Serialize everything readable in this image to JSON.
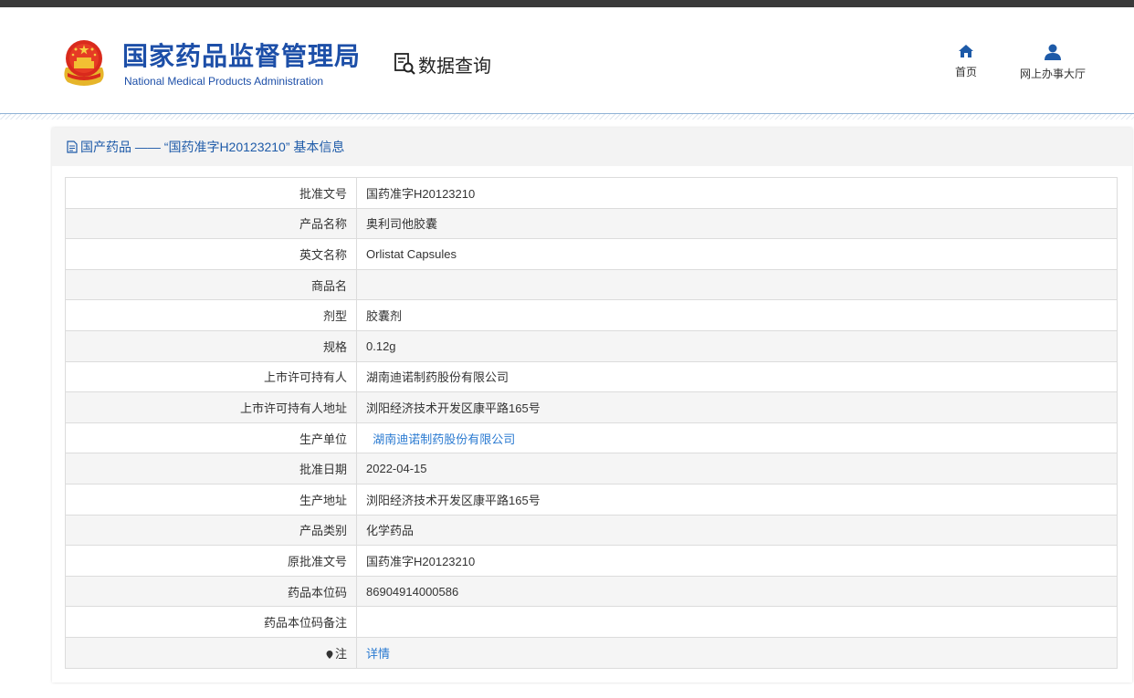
{
  "header": {
    "org_name_cn": "国家药品监督管理局",
    "org_name_en": "National Medical Products Administration",
    "query_title": "数据查询",
    "nav": [
      {
        "label": "首页",
        "icon": "home-icon"
      },
      {
        "label": "网上办事大厅",
        "icon": "user-icon"
      }
    ]
  },
  "card": {
    "title": "国产药品 —— “国药准字H20123210” 基本信息"
  },
  "table": {
    "rows": [
      {
        "label": "批准文号",
        "value": "国药准字H20123210"
      },
      {
        "label": "产品名称",
        "value": "奥利司他胶囊"
      },
      {
        "label": "英文名称",
        "value": "Orlistat Capsules"
      },
      {
        "label": "商品名",
        "value": ""
      },
      {
        "label": "剂型",
        "value": "胶囊剂"
      },
      {
        "label": "规格",
        "value": "0.12g"
      },
      {
        "label": "上市许可持有人",
        "value": "湖南迪诺制药股份有限公司"
      },
      {
        "label": "上市许可持有人地址",
        "value": "浏阳经济技术开发区康平路165号"
      },
      {
        "label": "生产单位",
        "value": "湖南迪诺制药股份有限公司"
      },
      {
        "label": "批准日期",
        "value": "2022-04-15"
      },
      {
        "label": "生产地址",
        "value": "浏阳经济技术开发区康平路165号"
      },
      {
        "label": "产品类别",
        "value": "化学药品"
      },
      {
        "label": "原批准文号",
        "value": "国药准字H20123210"
      },
      {
        "label": "药品本位码",
        "value": "86904914000586"
      },
      {
        "label": "药品本位码备注",
        "value": ""
      },
      {
        "label": "注",
        "value": "详情"
      }
    ]
  },
  "colors": {
    "brand_blue": "#1d4fa8",
    "link_blue": "#2a7ad1",
    "topbar": "#3a3a3a"
  }
}
